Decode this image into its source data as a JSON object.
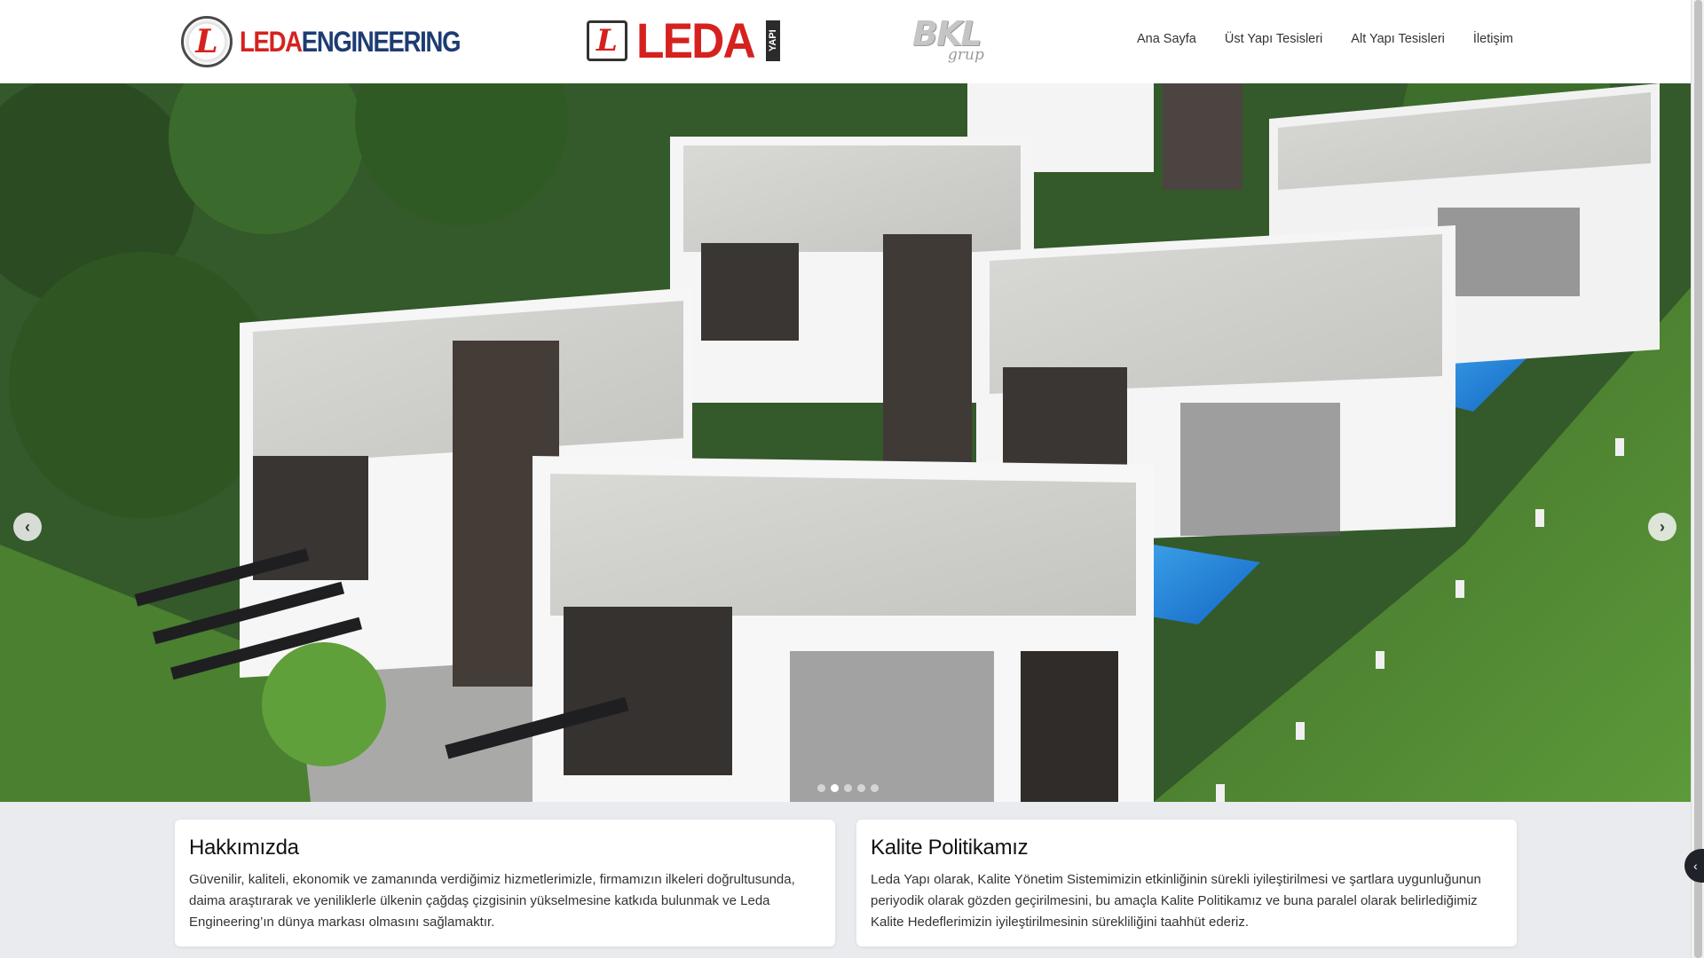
{
  "header": {
    "logo_engineering": {
      "emblem": "L",
      "leda": "LEDA",
      "engineering": "ENGINEERING"
    },
    "logo_yapi": {
      "emblem": "L",
      "word": "LEDA",
      "sub": "YAPI"
    },
    "logo_bkl": {
      "word": "BKL",
      "sub": "grup"
    },
    "nav": [
      "Ana Sayfa",
      "Üst Yapı Tesisleri",
      "Alt Yapı Tesisleri",
      "İletişim"
    ]
  },
  "hero": {
    "prev_icon": "chevron-left-icon",
    "next_icon": "chevron-right-icon",
    "prev_glyph": "‹",
    "next_glyph": "›",
    "slide_count": 5,
    "active_slide": 1
  },
  "cards": [
    {
      "title": "Hakkımızda",
      "text": "Güvenilir, kaliteli, ekonomik ve zamanında verdiğimiz hizmetlerimizle, firmamızın ilkeleri doğrultusunda, daima araştırarak ve yeniliklerle ülkenin çağdaş çizgisinin yükselmesine katkıda bulunmak ve Leda Engineering’ın dünya markası olmasını sağlamaktır."
    },
    {
      "title": "Kalite Politikamız",
      "text": "Leda Yapı olarak, Kalite Yönetim Sistemimizin etkinliğinin sürekli iyileştirilmesi ve şartlara uygunluğunun periyodik olarak gözden geçirilmesini, bu amaçla Kalite Politikamız ve buna paralel olarak belirlediğimiz Kalite Hedeflerimizin iyileştirilmesinin sürekliliğini taahhüt ederiz."
    }
  ],
  "side_toggle_glyph": "‹",
  "colors": {
    "brand_red": "#d5221f",
    "brand_blue": "#1d3c72",
    "page_bg": "#e9ebef"
  }
}
